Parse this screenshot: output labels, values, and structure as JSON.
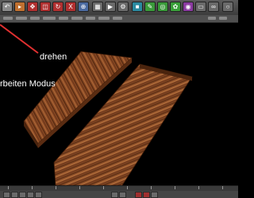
{
  "toolbar": {
    "icons": [
      {
        "name": "undo-icon",
        "glyph": "↶",
        "color": "#8a8a8a"
      },
      {
        "name": "live-selection-icon",
        "glyph": "▸",
        "color": "#c07030"
      },
      {
        "name": "move-icon",
        "glyph": "✥",
        "color": "#b03030"
      },
      {
        "name": "scale-icon",
        "glyph": "◫",
        "color": "#b03030"
      },
      {
        "name": "rotate-icon",
        "glyph": "↻",
        "color": "#b03030"
      },
      {
        "name": "xyz-icon",
        "glyph": "X",
        "color": "#b03030"
      },
      {
        "name": "coordinate-system-icon",
        "glyph": "⊕",
        "color": "#4a6aa0"
      },
      {
        "name": "render-view-icon",
        "glyph": "▦",
        "color": "#6a6a6a"
      },
      {
        "name": "render-icon",
        "glyph": "▶",
        "color": "#6a6a6a"
      },
      {
        "name": "render-settings-icon",
        "glyph": "⚙",
        "color": "#6a6a6a"
      },
      {
        "name": "cube-icon",
        "glyph": "■",
        "color": "#2a8aa0"
      },
      {
        "name": "spline-icon",
        "glyph": "✎",
        "color": "#3a9a3a"
      },
      {
        "name": "nurbs-icon",
        "glyph": "◎",
        "color": "#3a9a3a"
      },
      {
        "name": "array-icon",
        "glyph": "✿",
        "color": "#3aa03a"
      },
      {
        "name": "deformer-icon",
        "glyph": "◉",
        "color": "#8a3aa0"
      },
      {
        "name": "scene-icon",
        "glyph": "▭",
        "color": "#6a6a6a"
      },
      {
        "name": "camera-icon",
        "glyph": "∞",
        "color": "#6a6a6a"
      },
      {
        "name": "light-icon",
        "glyph": "○",
        "color": "#6a6a6a"
      }
    ]
  },
  "viewport": {
    "annotation_rotate": "drehen",
    "annotation_edit_mode": "rbeiten Modus",
    "arrow_color": "#e03030"
  },
  "timeline": {
    "buttons": [
      "go-to-start",
      "previous-key",
      "previous-frame",
      "play",
      "next-frame",
      "next-key",
      "go-to-end",
      "record",
      "autokey",
      "keyframe-selection"
    ]
  }
}
